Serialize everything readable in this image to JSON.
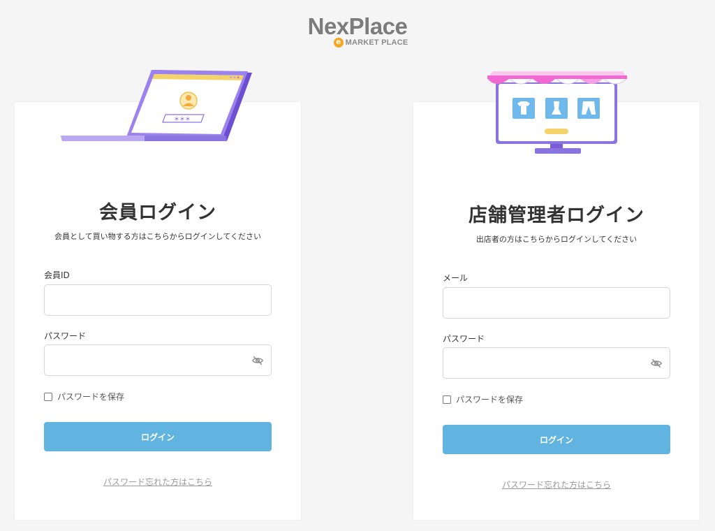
{
  "logo": {
    "name": "NexPlace",
    "badge": "e",
    "tagline": "MARKET PLACE"
  },
  "member": {
    "title": "会員ログイン",
    "subtitle": "会員として買い物する方はこちらからログインしてください",
    "id_label": "会員ID",
    "id_value": "",
    "password_label": "パスワード",
    "password_value": "",
    "remember_label": "パスワードを保存",
    "remember_checked": false,
    "login_label": "ログイン",
    "forgot_label": "パスワード忘れた方はこちら",
    "illustration_masked_password": "＊＊＊"
  },
  "store": {
    "title": "店舗管理者ログイン",
    "subtitle": "出店者の方はこちらからログインしてください",
    "email_label": "メール",
    "email_value": "",
    "password_label": "パスワード",
    "password_value": "",
    "remember_label": "パスワードを保存",
    "remember_checked": false,
    "login_label": "ログイン",
    "forgot_label": "パスワード忘れた方はこちら"
  },
  "colors": {
    "button": "#62b4e0",
    "logo_text": "#7c7c7c",
    "logo_badge": "#f5a623",
    "laptop_purple": "#7b5cd6",
    "awning_pink": "#f06ad2"
  },
  "icons": {
    "password_toggle": "eye-slash-icon",
    "laptop": "laptop-login-illustration",
    "shop": "storefront-monitor-illustration"
  }
}
